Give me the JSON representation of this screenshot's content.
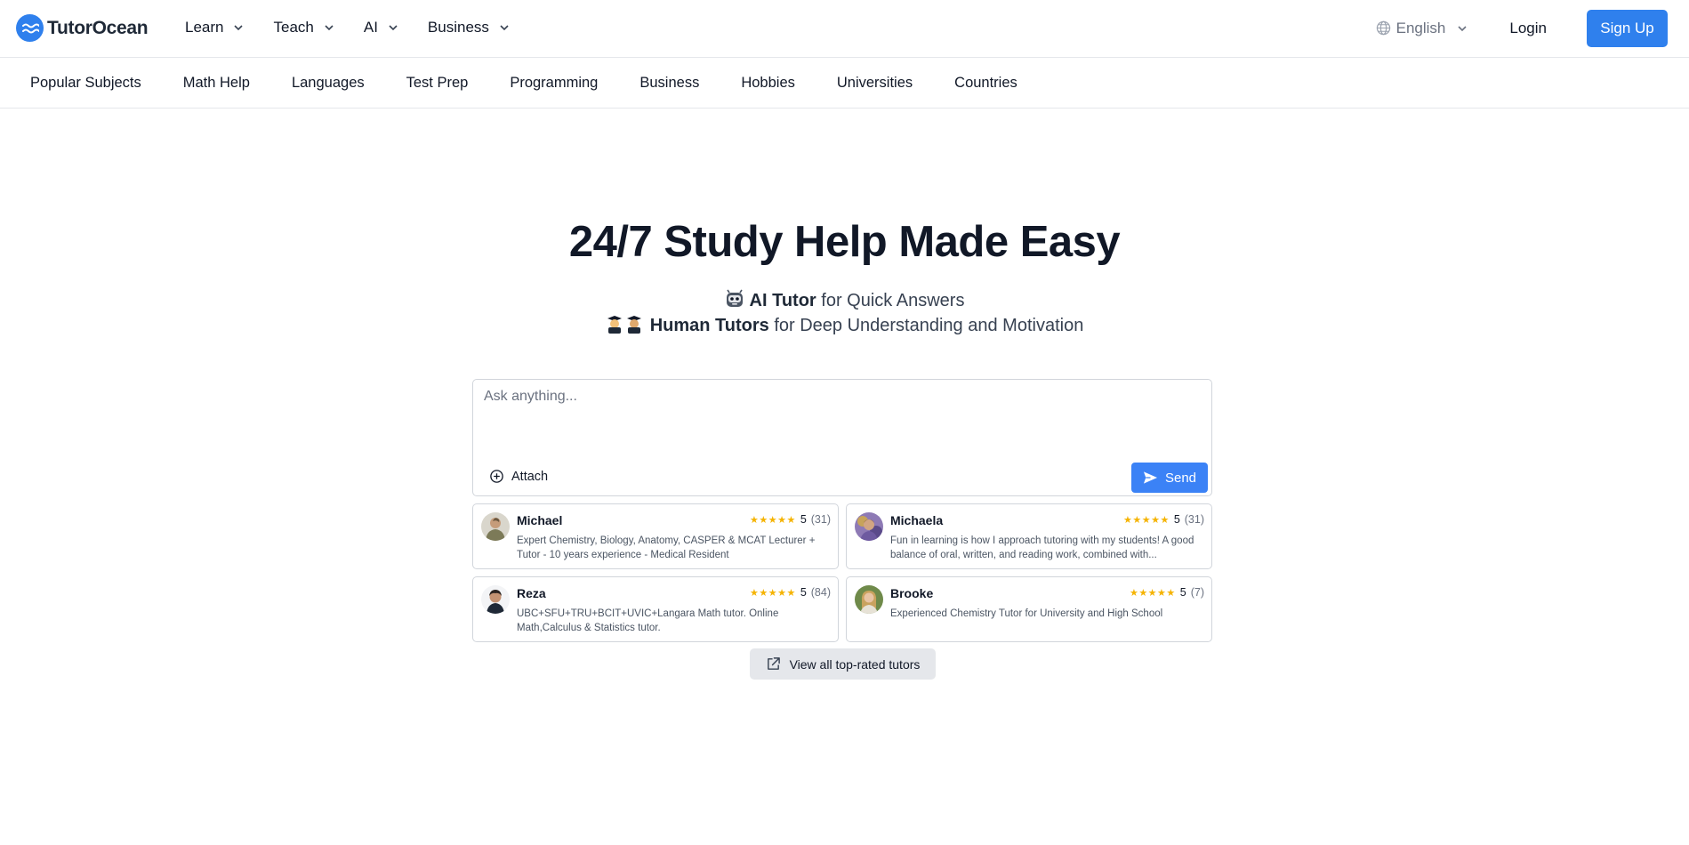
{
  "brand": {
    "name": "TutorOcean",
    "accent_color": "#2f80ed"
  },
  "header": {
    "nav": [
      {
        "label": "Learn"
      },
      {
        "label": "Teach"
      },
      {
        "label": "AI"
      },
      {
        "label": "Business"
      }
    ],
    "language": "English",
    "login_label": "Login",
    "signup_label": "Sign Up"
  },
  "subjects": [
    "Popular Subjects",
    "Math Help",
    "Languages",
    "Test Prep",
    "Programming",
    "Business",
    "Hobbies",
    "Universities",
    "Countries"
  ],
  "hero": {
    "title": "24/7 Study Help Made Easy",
    "ai_line": {
      "emoji_icon": "robot-face-icon",
      "bold": "AI Tutor",
      "rest": " for Quick Answers"
    },
    "human_line": {
      "emoji_icon": "graduates-icon",
      "bold": "Human Tutors",
      "rest": " for Deep Understanding and Motivation"
    }
  },
  "ask": {
    "placeholder": "Ask anything...",
    "value": "",
    "attach_label": "Attach",
    "send_label": "Send"
  },
  "tutors": [
    {
      "name": "Michael",
      "rating": "5",
      "reviews": "(31)",
      "stars": 5,
      "description": "Expert Chemistry, Biology, Anatomy, CASPER & MCAT Lecturer + Tutor - 10 years experience - Medical Resident"
    },
    {
      "name": "Michaela",
      "rating": "5",
      "reviews": "(31)",
      "stars": 5,
      "description": "Fun in learning is how I approach tutoring with my students! A good balance of oral, written, and reading work, combined with..."
    },
    {
      "name": "Reza",
      "rating": "5",
      "reviews": "(84)",
      "stars": 5,
      "description": "UBC+SFU+TRU+BCIT+UVIC+Langara Math tutor. Online Math,Calculus & Statistics tutor."
    },
    {
      "name": "Brooke",
      "rating": "5",
      "reviews": "(7)",
      "stars": 5,
      "description": "Experienced Chemistry Tutor for University and High School"
    }
  ],
  "view_all_label": "View all top-rated tutors"
}
